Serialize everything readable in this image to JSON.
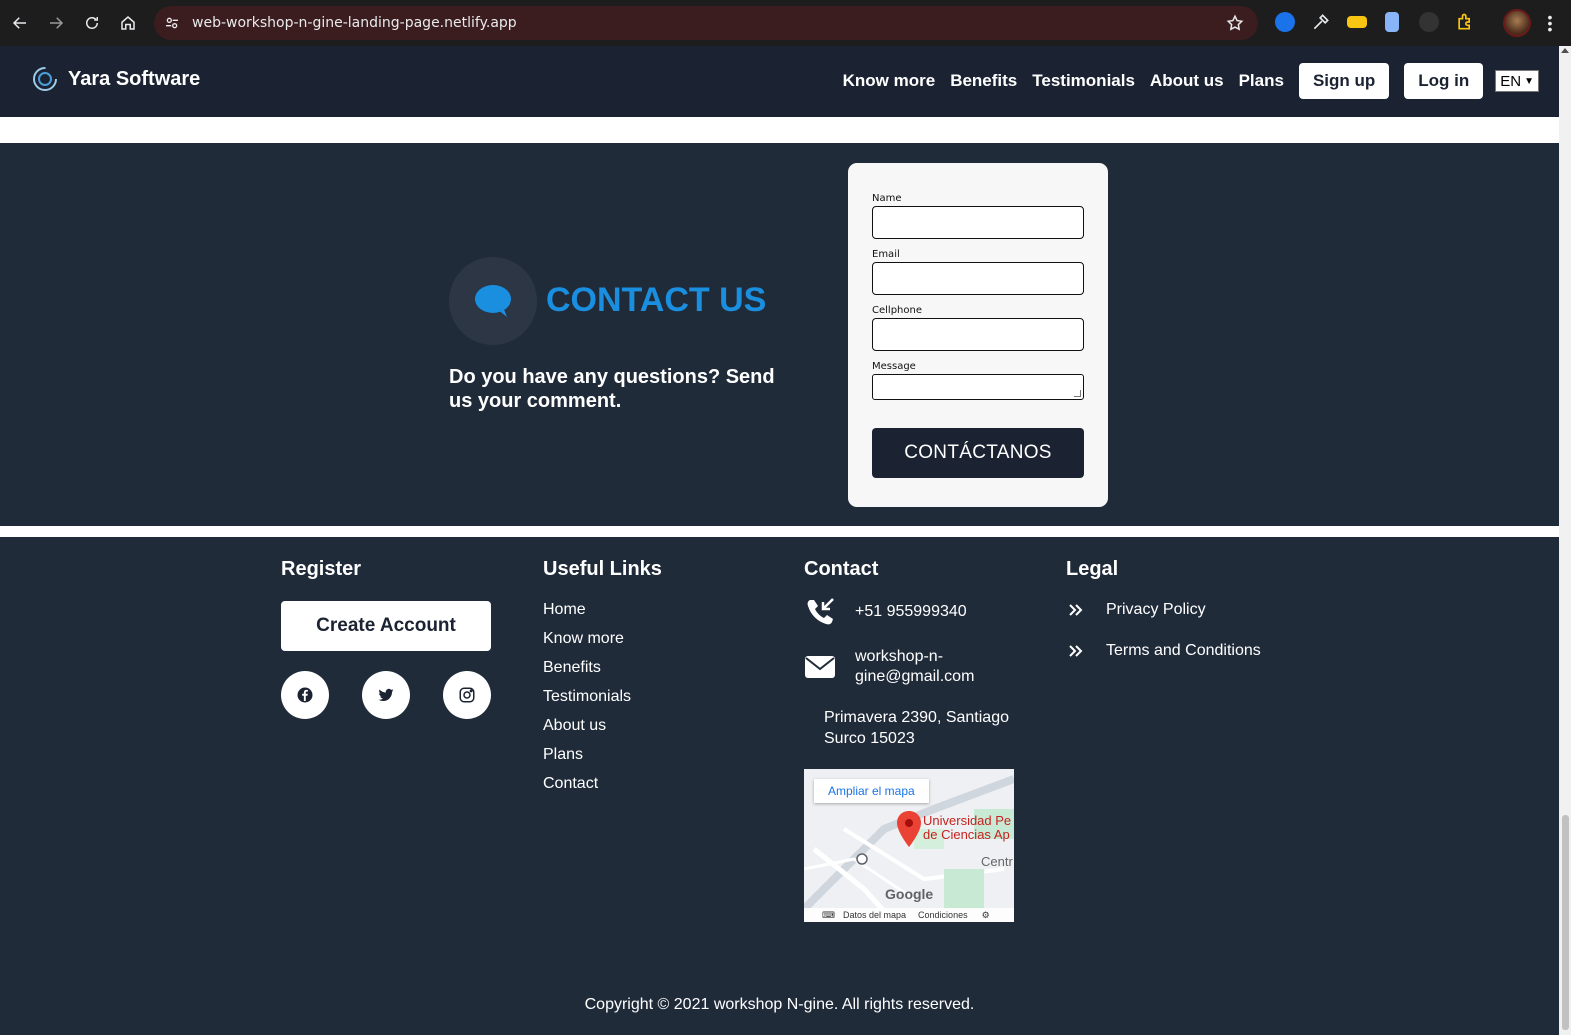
{
  "browser": {
    "url": "web-workshop-n-gine-landing-page.netlify.app"
  },
  "header": {
    "brand_name": "Yara Software",
    "nav": [
      "Know more",
      "Benefits",
      "Testimonials",
      "About us",
      "Plans"
    ],
    "sign_up": "Sign up",
    "log_in": "Log in",
    "language": "EN"
  },
  "contact": {
    "title": "CONTACT US",
    "subtitle": "Do you have any questions? Send us your comment.",
    "form": {
      "name_label": "Name",
      "email_label": "Email",
      "cellphone_label": "Cellphone",
      "message_label": "Message",
      "submit_label": "CONTÁCTANOS"
    }
  },
  "footer": {
    "register_title": "Register",
    "create_account": "Create Account",
    "social": [
      "facebook-icon",
      "twitter-icon",
      "instagram-icon"
    ],
    "links_title": "Useful Links",
    "links": [
      "Home",
      "Know more",
      "Benefits",
      "Testimonials",
      "About us",
      "Plans",
      "Contact"
    ],
    "contact_title": "Contact",
    "phone": "+51 955999340",
    "email": "workshop-n-gine@gmail.com",
    "address": "Primavera 2390, Santiago Surco 15023",
    "map": {
      "expand_label": "Ampliar el mapa",
      "place": "Universidad Pe de Ciencias Ap",
      "area": "Centr",
      "google": "Google",
      "map_data": "Datos del mapa",
      "terms": "Condiciones"
    },
    "legal_title": "Legal",
    "legal": [
      "Privacy Policy",
      "Terms and Conditions"
    ],
    "copyright": "Copyright © 2021 workshop N-gine. All rights reserved."
  }
}
